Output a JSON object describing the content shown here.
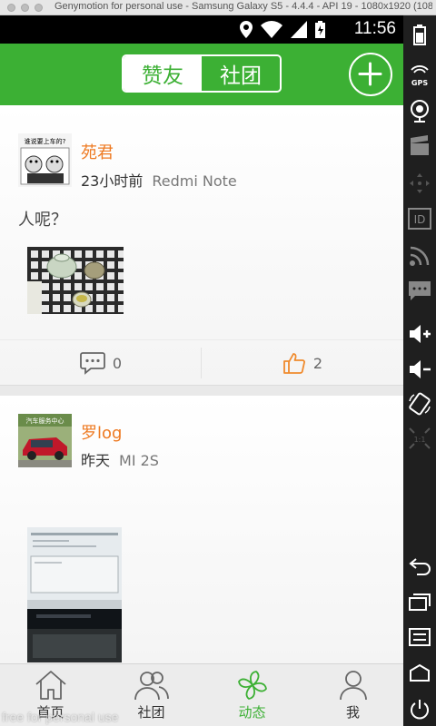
{
  "window": {
    "title": "Genymotion for personal use - Samsung Galaxy S5 - 4.4.4 - API 19 - 1080x1920 (1080..."
  },
  "status_bar": {
    "time": "11:56",
    "icons": [
      "location-icon",
      "wifi-icon",
      "signal-icon",
      "battery-charging-icon"
    ]
  },
  "header": {
    "tabs": [
      {
        "label": "赞友",
        "active": true
      },
      {
        "label": "社团",
        "active": false
      }
    ],
    "add_icon": "plus-circle-icon",
    "accent_color": "#3cb034"
  },
  "feed": {
    "posts": [
      {
        "username": "苑君",
        "time": "23小时前",
        "device": "Redmi Note",
        "text": "人呢？",
        "avatar_caption": "谁说要上车的?",
        "comment_count": "0",
        "like_count": "2"
      },
      {
        "username": "罗log",
        "time": "昨天",
        "device": "MI 2S",
        "avatar_caption": "汽车服务中心"
      }
    ]
  },
  "tabbar": {
    "items": [
      {
        "label": "首页",
        "icon": "home-icon",
        "active": false
      },
      {
        "label": "社团",
        "icon": "people-icon",
        "active": false
      },
      {
        "label": "动态",
        "icon": "pinwheel-icon",
        "active": true
      },
      {
        "label": "我",
        "icon": "person-icon",
        "active": false
      }
    ]
  },
  "watermark": "free for personal use",
  "emulator_sidebar": {
    "gps_label": "GPS",
    "id_label": "ID",
    "pixel_label": "1:1",
    "icons": [
      "battery-icon",
      "gps-icon",
      "webcam-icon",
      "clapper-icon",
      "dpad-icon",
      "id-icon",
      "rss-icon",
      "message-icon",
      "volume-up-icon",
      "volume-down-icon",
      "rotate-icon",
      "pixel-perfect-icon",
      "back-icon",
      "recent-apps-icon",
      "menu-icon",
      "home-icon",
      "power-icon"
    ]
  }
}
